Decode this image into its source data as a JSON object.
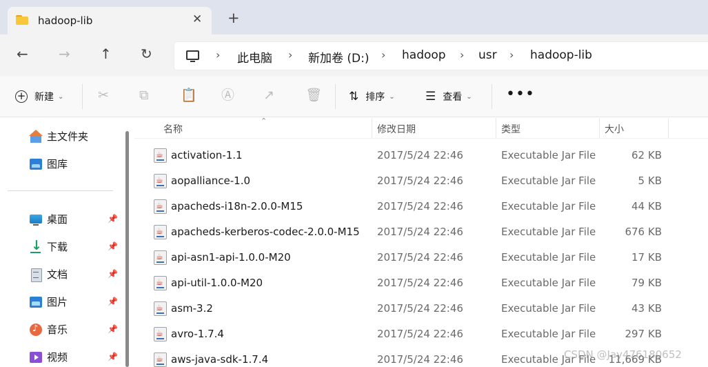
{
  "tab": {
    "title": "hadoop-lib",
    "close": "✕",
    "new": "+"
  },
  "nav": {
    "back": "←",
    "forward": "→",
    "up": "↑",
    "refresh": "↻"
  },
  "address": {
    "items": [
      "此电脑",
      "新加卷 (D:)",
      "hadoop",
      "usr",
      "hadoop-lib"
    ],
    "separator": "›"
  },
  "toolbar": {
    "new_label": "新建",
    "sort_label": "排序",
    "view_label": "查看",
    "more": "•••"
  },
  "sidebar": {
    "quick": [
      {
        "label": "主文件夹",
        "icon": "home-icon"
      },
      {
        "label": "图库",
        "icon": "gallery-icon"
      }
    ],
    "pinned": [
      {
        "label": "桌面",
        "icon": "desktop-icon"
      },
      {
        "label": "下载",
        "icon": "download-icon"
      },
      {
        "label": "文档",
        "icon": "documents-icon"
      },
      {
        "label": "图片",
        "icon": "pictures-icon"
      },
      {
        "label": "音乐",
        "icon": "music-icon"
      },
      {
        "label": "视频",
        "icon": "videos-icon"
      }
    ]
  },
  "columns": {
    "name": "名称",
    "date": "修改日期",
    "type": "类型",
    "size": "大小"
  },
  "files": [
    {
      "name": "activation-1.1",
      "date": "2017/5/24 22:46",
      "type": "Executable Jar File",
      "size": "62 KB"
    },
    {
      "name": "aopalliance-1.0",
      "date": "2017/5/24 22:46",
      "type": "Executable Jar File",
      "size": "5 KB"
    },
    {
      "name": "apacheds-i18n-2.0.0-M15",
      "date": "2017/5/24 22:46",
      "type": "Executable Jar File",
      "size": "44 KB"
    },
    {
      "name": "apacheds-kerberos-codec-2.0.0-M15",
      "date": "2017/5/24 22:46",
      "type": "Executable Jar File",
      "size": "676 KB"
    },
    {
      "name": "api-asn1-api-1.0.0-M20",
      "date": "2017/5/24 22:46",
      "type": "Executable Jar File",
      "size": "17 KB"
    },
    {
      "name": "api-util-1.0.0-M20",
      "date": "2017/5/24 22:46",
      "type": "Executable Jar File",
      "size": "79 KB"
    },
    {
      "name": "asm-3.2",
      "date": "2017/5/24 22:46",
      "type": "Executable Jar File",
      "size": "43 KB"
    },
    {
      "name": "avro-1.7.4",
      "date": "2017/5/24 22:46",
      "type": "Executable Jar File",
      "size": "297 KB"
    },
    {
      "name": "aws-java-sdk-1.7.4",
      "date": "2017/5/24 22:46",
      "type": "Executable Jar File",
      "size": "11,669 KB"
    }
  ],
  "watermark": "CSDN @Jay476180652"
}
